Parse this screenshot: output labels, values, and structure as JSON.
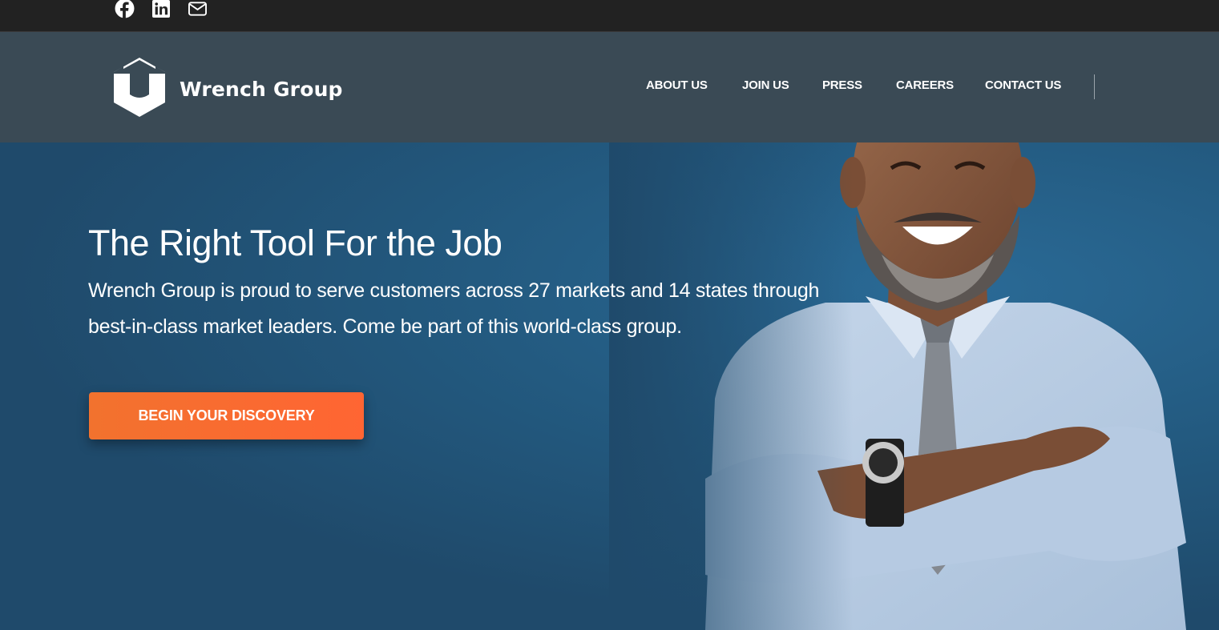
{
  "social": {
    "icons": [
      "facebook-icon",
      "linkedin-icon",
      "email-icon"
    ]
  },
  "header": {
    "brand": "Wrench Group",
    "nav": [
      "ABOUT US",
      "JOIN US",
      "PRESS",
      "CAREERS",
      "CONTACT US"
    ]
  },
  "hero": {
    "title": "The Right Tool For the Job",
    "description": "Wrench Group is proud to serve customers across 27 markets and 14 states through best-in-class market leaders. Come be part of this world-class group.",
    "cta_label": "BEGIN YOUR DISCOVERY"
  },
  "colors": {
    "topbar": "#222222",
    "header": "#3a4a55",
    "hero": "#1f4a6b",
    "cta": "#f2722e",
    "text": "#ffffff"
  }
}
